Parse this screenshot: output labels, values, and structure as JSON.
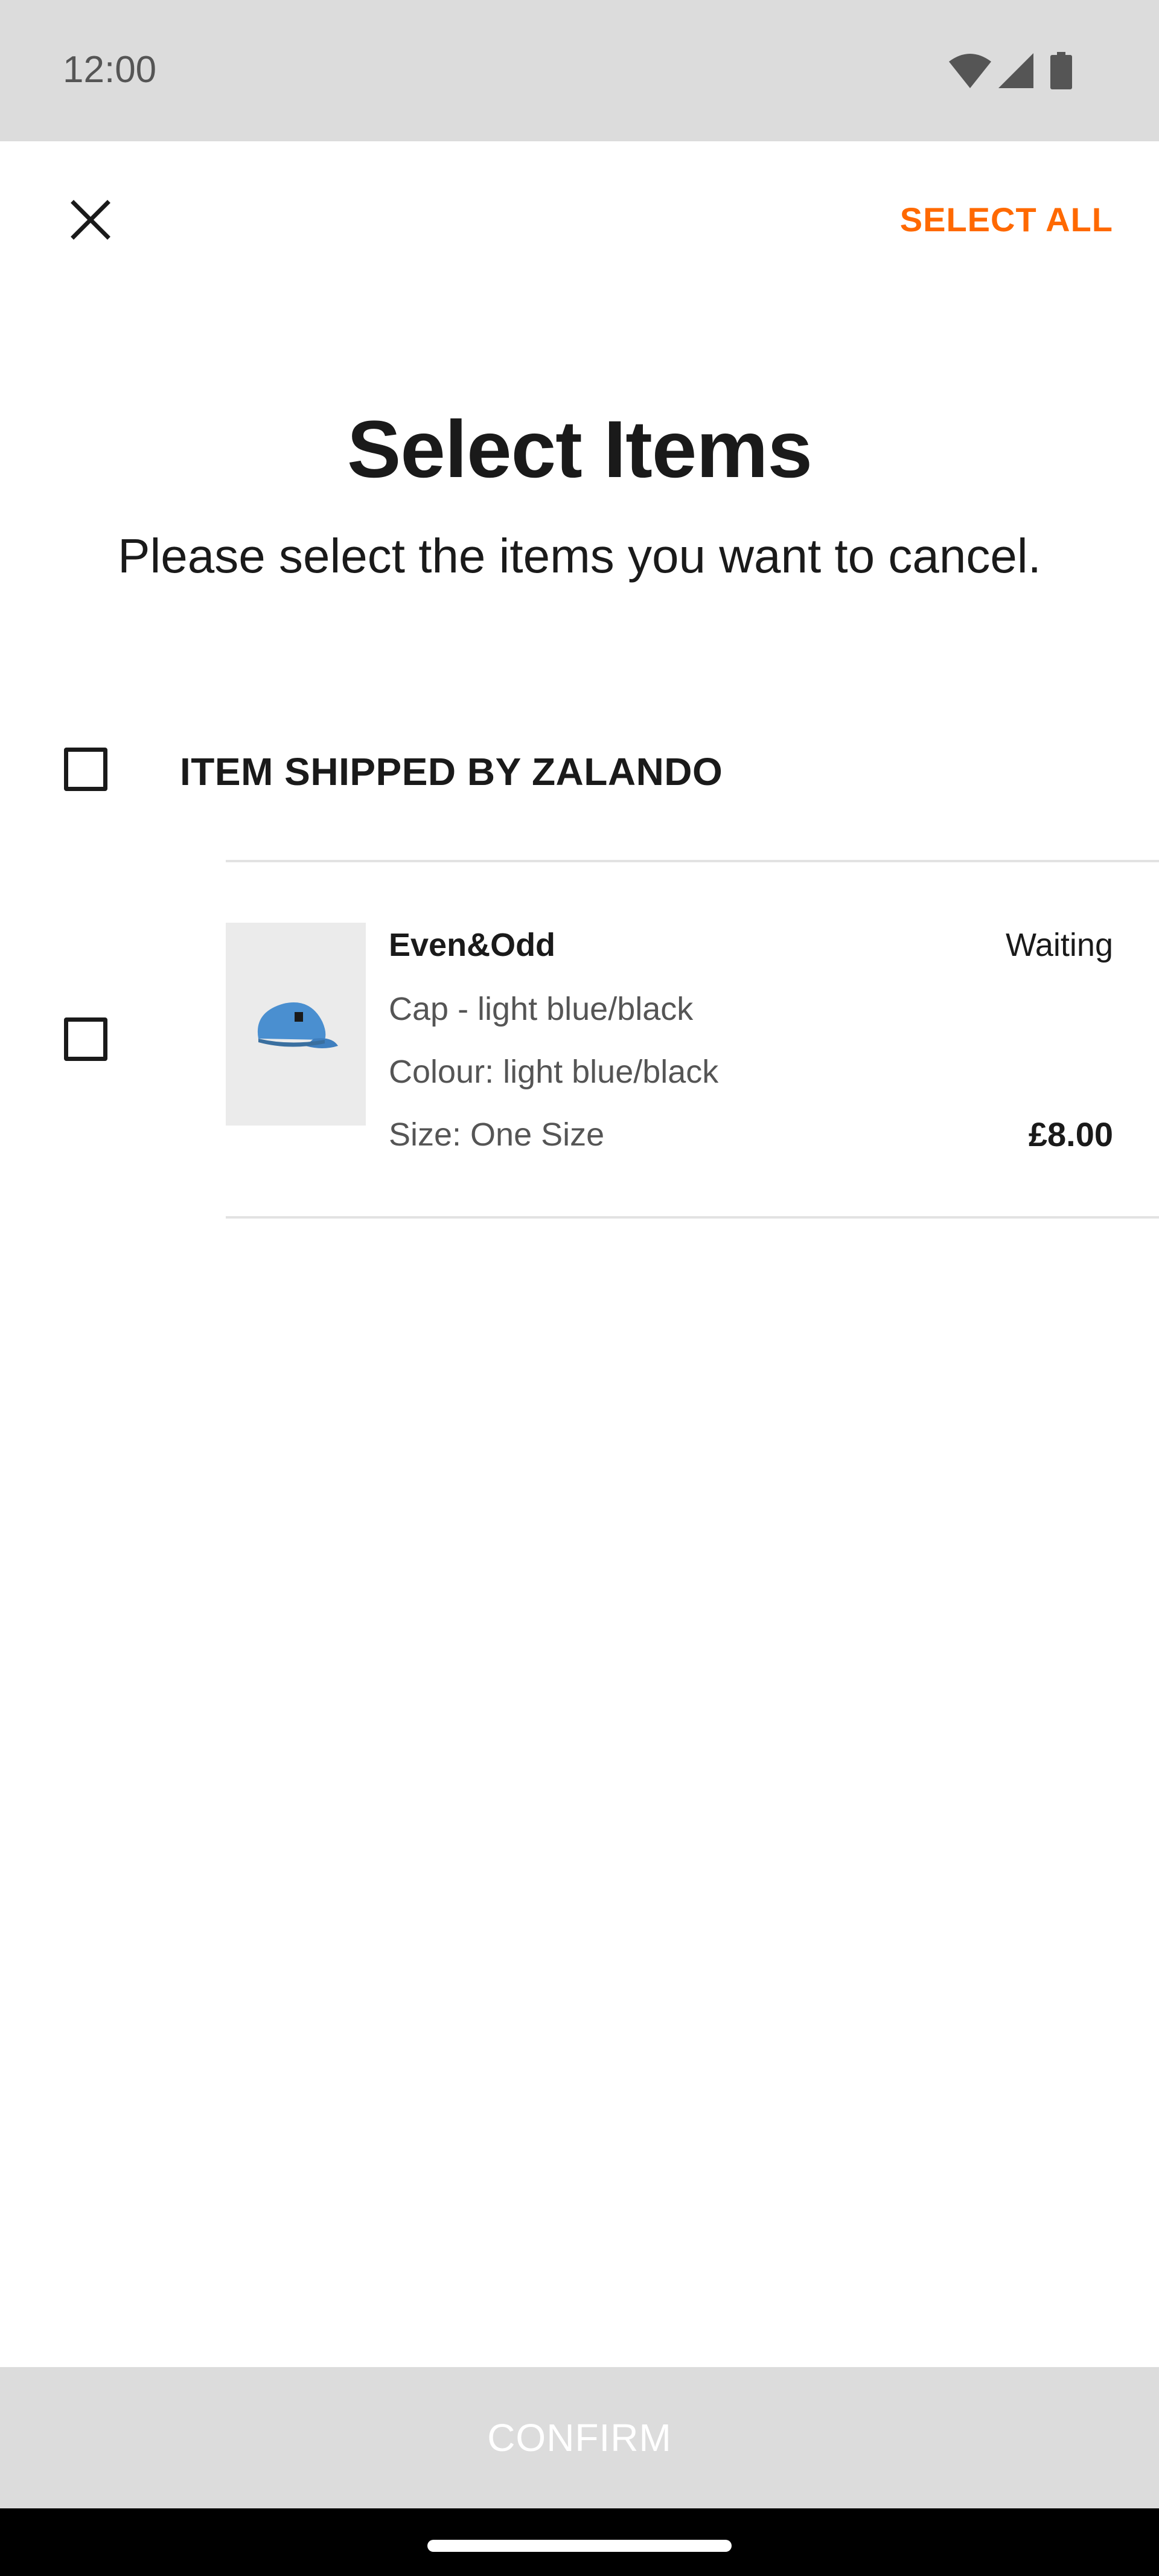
{
  "status_bar": {
    "time": "12:00",
    "icons": [
      "wifi-icon",
      "signal-icon",
      "battery-icon"
    ]
  },
  "top_bar": {
    "close_icon": "close-icon",
    "select_all_label": "SELECT ALL"
  },
  "header": {
    "title": "Select Items",
    "subtitle": "Please select the items you want to cancel."
  },
  "group": {
    "label": "ITEM SHIPPED BY ZALANDO",
    "checked": false
  },
  "items": [
    {
      "brand": "Even&Odd",
      "status": "Waiting",
      "name": "Cap - light blue/black",
      "colour": "Colour: light blue/black",
      "size": "Size: One Size",
      "price": "£8.00",
      "image_icon": "cap-icon",
      "checked": false
    }
  ],
  "footer": {
    "confirm_label": "CONFIRM",
    "enabled": false
  },
  "colors": {
    "accent": "#ff6900",
    "text": "#1a1a1a",
    "secondary_text": "#555555",
    "disabled_bg": "#dcdcdc",
    "divider": "#e2e2e2"
  }
}
